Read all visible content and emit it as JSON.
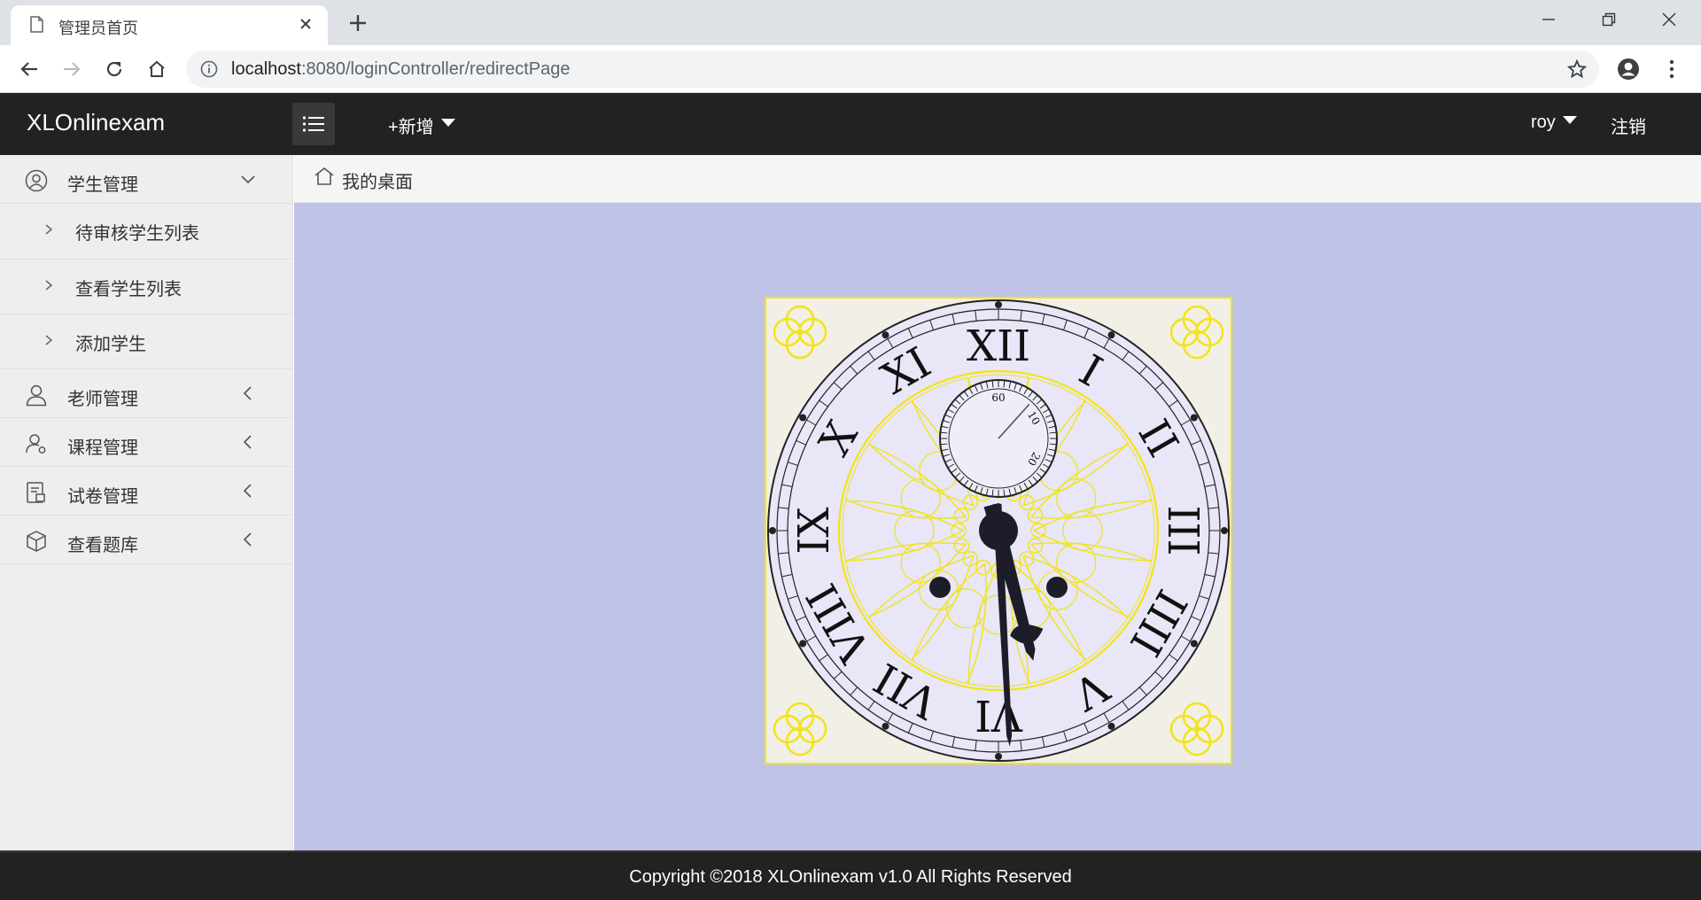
{
  "browser": {
    "tab_title": "管理员首页",
    "url_host": "localhost",
    "url_rest": ":8080/loginController/redirectPage"
  },
  "header": {
    "brand": "XLOnlinexam",
    "add_label": "+新增",
    "user_label": "roy",
    "logout_label": "注销"
  },
  "sidebar": {
    "groups": [
      {
        "label": "学生管理",
        "icon": "user-circle-icon",
        "expanded": true,
        "items": [
          {
            "label": "待审核学生列表"
          },
          {
            "label": "查看学生列表"
          },
          {
            "label": "添加学生"
          }
        ]
      },
      {
        "label": "老师管理",
        "icon": "user-icon",
        "expanded": false
      },
      {
        "label": "课程管理",
        "icon": "user-settings-icon",
        "expanded": false
      },
      {
        "label": "试卷管理",
        "icon": "document-icon",
        "expanded": false
      },
      {
        "label": "查看题库",
        "icon": "cube-icon",
        "expanded": false
      }
    ]
  },
  "main": {
    "breadcrumb": "我的桌面",
    "clock": {
      "numerals": [
        "XII",
        "I",
        "II",
        "III",
        "IIII",
        "V",
        "VI",
        "VII",
        "VIII",
        "IX",
        "X",
        "XI"
      ],
      "sub_dial_labels": [
        "60",
        "10",
        "20"
      ],
      "hour": 5,
      "minute": 30,
      "second": 7
    }
  },
  "footer": {
    "copyright": "Copyright ©2018 XLOnlinexam v1.0 All Rights Reserved"
  },
  "colors": {
    "header_bg": "#222222",
    "content_bg": "#c0c3e8",
    "clock_gold": "#f2e416",
    "clock_face": "#e8e6f7"
  }
}
